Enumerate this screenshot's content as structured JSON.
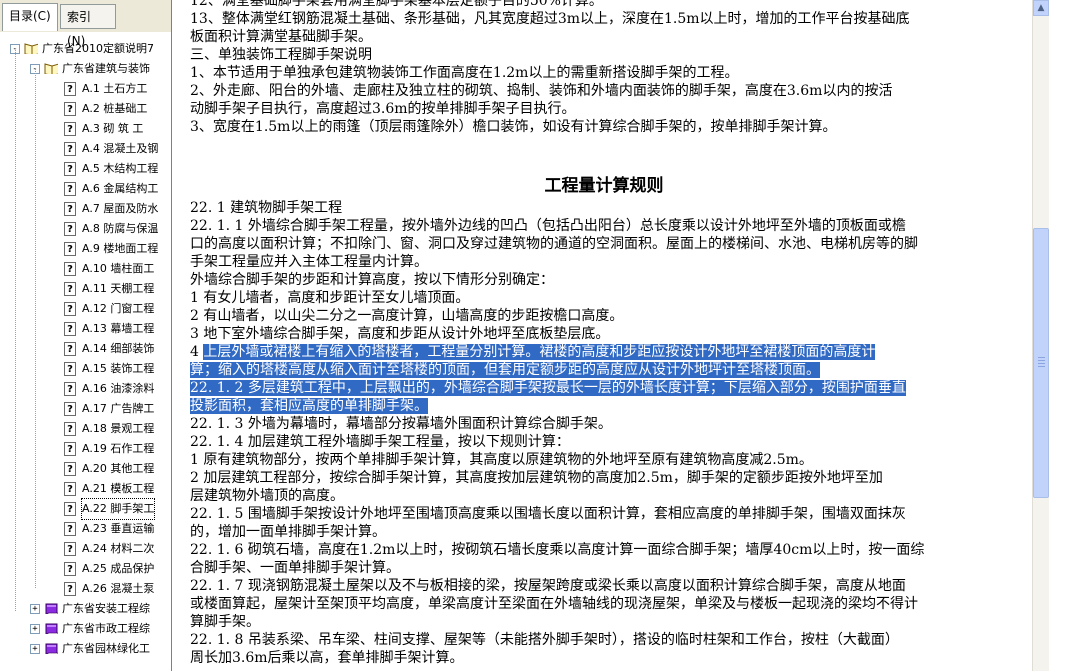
{
  "tabs": [
    {
      "label": "目录(C)",
      "active": true
    },
    {
      "label": "索引(N)",
      "active": false
    }
  ],
  "tree": [
    {
      "label": "广东省2010定额说明7",
      "level": 0,
      "icon": "book-open-icon",
      "expander": "-"
    },
    {
      "label": "广东省建筑与装饰",
      "level": 1,
      "icon": "book-open-icon",
      "expander": "-"
    },
    {
      "label": "A.1  土石方工",
      "level": 2,
      "icon": "help-page-icon"
    },
    {
      "label": "A.2  桩基础工",
      "level": 2,
      "icon": "help-page-icon"
    },
    {
      "label": "A.3  砌  筑  工",
      "level": 2,
      "icon": "help-page-icon"
    },
    {
      "label": "A.4  混凝土及钢",
      "level": 2,
      "icon": "help-page-icon"
    },
    {
      "label": "A.5  木结构工程",
      "level": 2,
      "icon": "help-page-icon"
    },
    {
      "label": "A.6  金属结构工",
      "level": 2,
      "icon": "help-page-icon"
    },
    {
      "label": "A.7 屋面及防水",
      "level": 2,
      "icon": "help-page-icon"
    },
    {
      "label": "A.8  防腐与保温",
      "level": 2,
      "icon": "help-page-icon"
    },
    {
      "label": "A.9  楼地面工程",
      "level": 2,
      "icon": "help-page-icon"
    },
    {
      "label": "A.10  墙柱面工",
      "level": 2,
      "icon": "help-page-icon"
    },
    {
      "label": "A.11  天棚工程",
      "level": 2,
      "icon": "help-page-icon"
    },
    {
      "label": "A.12  门窗工程",
      "level": 2,
      "icon": "help-page-icon"
    },
    {
      "label": "A.13  幕墙工程",
      "level": 2,
      "icon": "help-page-icon"
    },
    {
      "label": "A.14  细部装饰",
      "level": 2,
      "icon": "help-page-icon"
    },
    {
      "label": "A.15  装饰工程",
      "level": 2,
      "icon": "help-page-icon"
    },
    {
      "label": "A.16  油漆涂料",
      "level": 2,
      "icon": "help-page-icon"
    },
    {
      "label": "A.17  广告牌工",
      "level": 2,
      "icon": "help-page-icon"
    },
    {
      "label": "A.18  景观工程",
      "level": 2,
      "icon": "help-page-icon"
    },
    {
      "label": "A.19 石作工程",
      "level": 2,
      "icon": "help-page-icon"
    },
    {
      "label": "A.20  其他工程",
      "level": 2,
      "icon": "help-page-icon"
    },
    {
      "label": "A.21  模板工程",
      "level": 2,
      "icon": "help-page-icon"
    },
    {
      "label": "A.22  脚手架工",
      "level": 2,
      "icon": "help-page-icon",
      "selected": true
    },
    {
      "label": "A.23  垂直运输",
      "level": 2,
      "icon": "help-page-icon"
    },
    {
      "label": "A.24  材料二次",
      "level": 2,
      "icon": "help-page-icon"
    },
    {
      "label": "A.25  成品保护",
      "level": 2,
      "icon": "help-page-icon"
    },
    {
      "label": "A.26  混凝土泵",
      "level": 2,
      "icon": "help-page-icon"
    },
    {
      "label": "广东省安装工程综",
      "level": 1,
      "icon": "book-closed-icon",
      "expander": "+"
    },
    {
      "label": "广东省市政工程综",
      "level": 1,
      "icon": "book-closed-icon",
      "expander": "+"
    },
    {
      "label": "广东省园林绿化工",
      "level": 1,
      "icon": "book-closed-icon",
      "expander": "+"
    }
  ],
  "content": {
    "lines_top": [
      "    12、满堂基础脚手架套用满堂脚手架基本层定额子目的50%计算。",
      "    13、整体满堂红钢筋混凝土基础、条形基础，凡其宽度超过3m以上，深度在1.5m以上时，增加的工作平台按基础底",
      "板面积计算满堂基础脚手架。",
      "    三、单独装饰工程脚手架说明",
      "    1、本节适用于单独承包建筑物装饰工作面高度在1.2m以上的需重新搭设脚手架的工程。",
      "    2、外走廊、阳台的外墙、走廊柱及独立柱的砌筑、捣制、装饰和外墙内面装饰的脚手架，高度在3.6m以内的按活",
      "动脚手架子目执行，高度超过3.6m的按单排脚手架子目执行。",
      "    3、宽度在1.5m以上的雨篷（顶层雨篷除外）檐口装饰，如设有计算综合脚手架的，按单排脚手架计算。"
    ],
    "heading": "工程量计算规则",
    "lines_main": [
      {
        "text": "22. 1   建筑物脚手架工程",
        "hl": false
      },
      {
        "text": "22. 1. 1   外墙综合脚手架工程量，按外墙外边线的凹凸（包括凸出阳台）总长度乘以设计外地坪至外墙的顶板面或檐",
        "hl": false
      },
      {
        "text": "口的高度以面积计算；不扣除门、窗、洞口及穿过建筑物的通道的空洞面积。屋面上的楼梯间、水池、电梯机房等的脚",
        "hl": false
      },
      {
        "text": "手架工程量应并入主体工程量内计算。",
        "hl": false
      },
      {
        "text": "    外墙综合脚手架的步距和计算高度，按以下情形分别确定：",
        "hl": false
      },
      {
        "text": "    1  有女儿墙者，高度和步距计至女儿墙顶面。",
        "hl": false
      },
      {
        "text": "    2  有山墙者，以山尖二分之一高度计算，山墙高度的步距按檐口高度。",
        "hl": false
      },
      {
        "text": "    3  地下室外墙综合脚手架，高度和步距从设计外地坪至底板垫层底。",
        "hl": false
      },
      {
        "text": "    4  ",
        "hl": false,
        "hltext": "上层外墙或裙楼上有缩入的塔楼者，工程量分别计算。裙楼的高度和步距应按设计外地坪至裙楼顶面的高度计"
      },
      {
        "text": "算；缩入的塔楼高度从缩入面计至塔楼的顶面，但套用定额步距的高度应从设计外地坪计至塔楼顶面。",
        "hl": true
      },
      {
        "text": "22. 1. 2   多层建筑工程中，上层飘出的，外墙综合脚手架按最长一层的外墙长度计算；下层缩入部分，按围护面垂直",
        "hl": true
      },
      {
        "text": "投影面积，套相应高度的单排脚手架。",
        "hl": true
      },
      {
        "text": "22. 1. 3   外墙为幕墙时，幕墙部分按幕墙外围面积计算综合脚手架。",
        "hl": false
      },
      {
        "text": "22. 1. 4   加层建筑工程外墙脚手架工程量，按以下规则计算：",
        "hl": false
      },
      {
        "text": "    1  原有建筑物部分，按两个单排脚手架计算，其高度以原建筑物的外地坪至原有建筑物高度减2.5m。",
        "hl": false
      },
      {
        "text": "    2  加层建筑工程部分，按综合脚手架计算，其高度按加层建筑物的高度加2.5m，脚手架的定额步距按外地坪至加",
        "hl": false
      },
      {
        "text": "层建筑物外墙顶的高度。",
        "hl": false
      },
      {
        "text": "22. 1. 5   围墙脚手架按设计外地坪至围墙顶高度乘以围墙长度以面积计算，套相应高度的单排脚手架，围墙双面抹灰",
        "hl": false
      },
      {
        "text": "的，增加一面单排脚手架计算。",
        "hl": false
      },
      {
        "text": "22. 1. 6   砌筑石墙，高度在1.2m以上时，按砌筑石墙长度乘以高度计算一面综合脚手架；墙厚40cm以上时，按一面综",
        "hl": false
      },
      {
        "text": "合脚手架、一面单排脚手架计算。",
        "hl": false
      },
      {
        "text": "22. 1. 7   现浇钢筋混凝土屋架以及不与板相接的梁，按屋架跨度或梁长乘以高度以面积计算综合脚手架，高度从地面",
        "hl": false
      },
      {
        "text": "或楼面算起，屋架计至架顶平均高度，单梁高度计至梁面在外墙轴线的现浇屋架，单梁及与楼板一起现浇的梁均不得计",
        "hl": false
      },
      {
        "text": "算脚手架。",
        "hl": false
      },
      {
        "text": "22. 1. 8   吊装系梁、吊车梁、柱间支撑、屋架等（未能搭外脚手架时），搭设的临时柱架和工作台，按柱（大截面）",
        "hl": false
      },
      {
        "text": "周长加3.6m后乘以高，套单排脚手架计算。",
        "hl": false
      }
    ]
  },
  "scrollbar": {
    "position": 0.55
  }
}
